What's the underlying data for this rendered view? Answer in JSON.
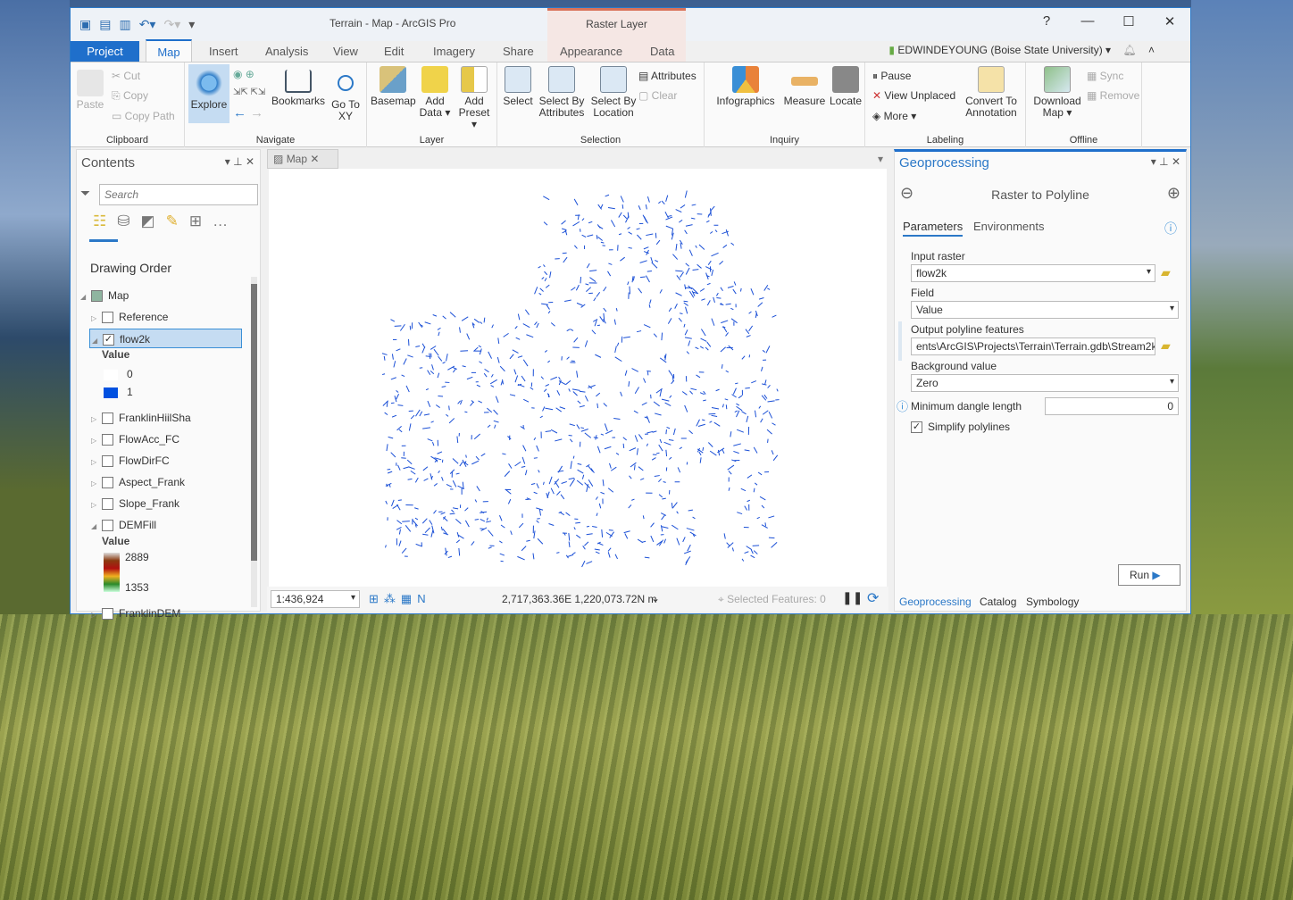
{
  "window": {
    "title": "Terrain - Map - ArcGIS Pro",
    "context_tab_group": "Raster Layer",
    "help": "?",
    "minimize": "—",
    "maximize": "☐",
    "close": "✕"
  },
  "tabs": [
    "Project",
    "Map",
    "Insert",
    "Analysis",
    "View",
    "Edit",
    "Imagery",
    "Share",
    "Appearance",
    "Data"
  ],
  "user": "EDWINDEYOUNG (Boise State University) ▾",
  "ribbon": {
    "clipboard": {
      "label": "Clipboard",
      "paste": "Paste",
      "cut": "Cut",
      "copy": "Copy",
      "copy_path": "Copy Path"
    },
    "navigate": {
      "label": "Navigate",
      "explore": "Explore",
      "bookmarks": "Bookmarks",
      "goto": "Go To XY"
    },
    "layer": {
      "label": "Layer",
      "basemap": "Basemap",
      "add_data": "Add Data ▾",
      "add_preset": "Add Preset ▾"
    },
    "selection": {
      "label": "Selection",
      "select": "Select",
      "by_attr": "Select By Attributes",
      "by_loc": "Select By Location",
      "attributes": "Attributes",
      "clear": "Clear"
    },
    "inquiry": {
      "label": "Inquiry",
      "infographics": "Infographics",
      "measure": "Measure",
      "locate": "Locate"
    },
    "labeling": {
      "label": "Labeling",
      "pause": "Pause",
      "view_unplaced": "View Unplaced",
      "more": "More ▾",
      "convert": "Convert To Annotation"
    },
    "offline": {
      "label": "Offline",
      "download": "Download Map ▾",
      "sync": "Sync",
      "remove": "Remove"
    }
  },
  "contents": {
    "title": "Contents",
    "search_placeholder": "Search",
    "drawing_order": "Drawing Order",
    "layers": [
      {
        "name": "Map",
        "checked": false
      },
      {
        "name": "Reference",
        "checked": false
      },
      {
        "name": "flow2k",
        "checked": true,
        "selected": true,
        "legend_title": "Value",
        "legend": [
          {
            "label": "0",
            "color": "#ffffff"
          },
          {
            "label": "1",
            "color": "#0050e0"
          }
        ]
      },
      {
        "name": "FranklinHiilSha",
        "checked": false
      },
      {
        "name": "FlowAcc_FC",
        "checked": false
      },
      {
        "name": "FlowDirFC",
        "checked": false
      },
      {
        "name": "Aspect_Frank",
        "checked": false
      },
      {
        "name": "Slope_Frank",
        "checked": false
      },
      {
        "name": "DEMFill",
        "checked": false,
        "legend_title": "Value",
        "legend_max": "2889",
        "legend_min": "1353"
      },
      {
        "name": "FranklinDEM",
        "checked": false
      }
    ]
  },
  "map": {
    "tab": "Map",
    "scale": "1:436,924",
    "coords": "2,717,363.36E 1,220,073.72N m",
    "selected_features": "Selected Features: 0",
    "stream_color": "#1a4fd6"
  },
  "geoprocessing": {
    "title": "Geoprocessing",
    "tool": "Raster to Polyline",
    "tabs": [
      "Parameters",
      "Environments"
    ],
    "input_raster_label": "Input raster",
    "input_raster": "flow2k",
    "field_label": "Field",
    "field": "Value",
    "output_label": "Output polyline features",
    "output": "ents\\ArcGIS\\Projects\\Terrain\\Terrain.gdb\\Stream2k",
    "background_label": "Background value",
    "background": "Zero",
    "dangle_label": "Minimum dangle length",
    "dangle": "0",
    "simplify_label": "Simplify polylines",
    "simplify": true,
    "run": "Run",
    "bottom_tabs": [
      "Geoprocessing",
      "Catalog",
      "Symbology"
    ]
  }
}
